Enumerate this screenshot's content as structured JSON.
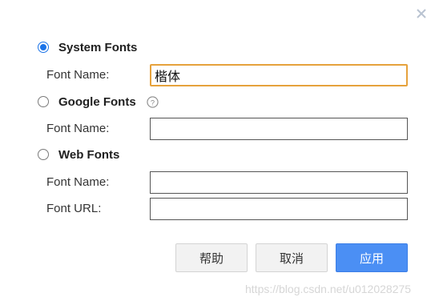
{
  "dialog": {
    "close_icon": "close-icon"
  },
  "system_fonts": {
    "label": "System Fonts",
    "selected": true,
    "font_name_label": "Font Name:",
    "font_name_value": "楷体"
  },
  "google_fonts": {
    "label": "Google Fonts",
    "selected": false,
    "help_icon": "help-icon",
    "font_name_label": "Font Name:",
    "font_name_value": ""
  },
  "web_fonts": {
    "label": "Web Fonts",
    "selected": false,
    "font_name_label": "Font Name:",
    "font_name_value": "",
    "font_url_label": "Font URL:",
    "font_url_value": ""
  },
  "buttons": {
    "help_label": "帮助",
    "cancel_label": "取消",
    "apply_label": "应用"
  },
  "colors": {
    "accent": "#1a73e8",
    "apply_button": "#4b8ff4",
    "focus_border": "#e6a23c"
  },
  "watermark": "https://blog.csdn.net/u012028275"
}
